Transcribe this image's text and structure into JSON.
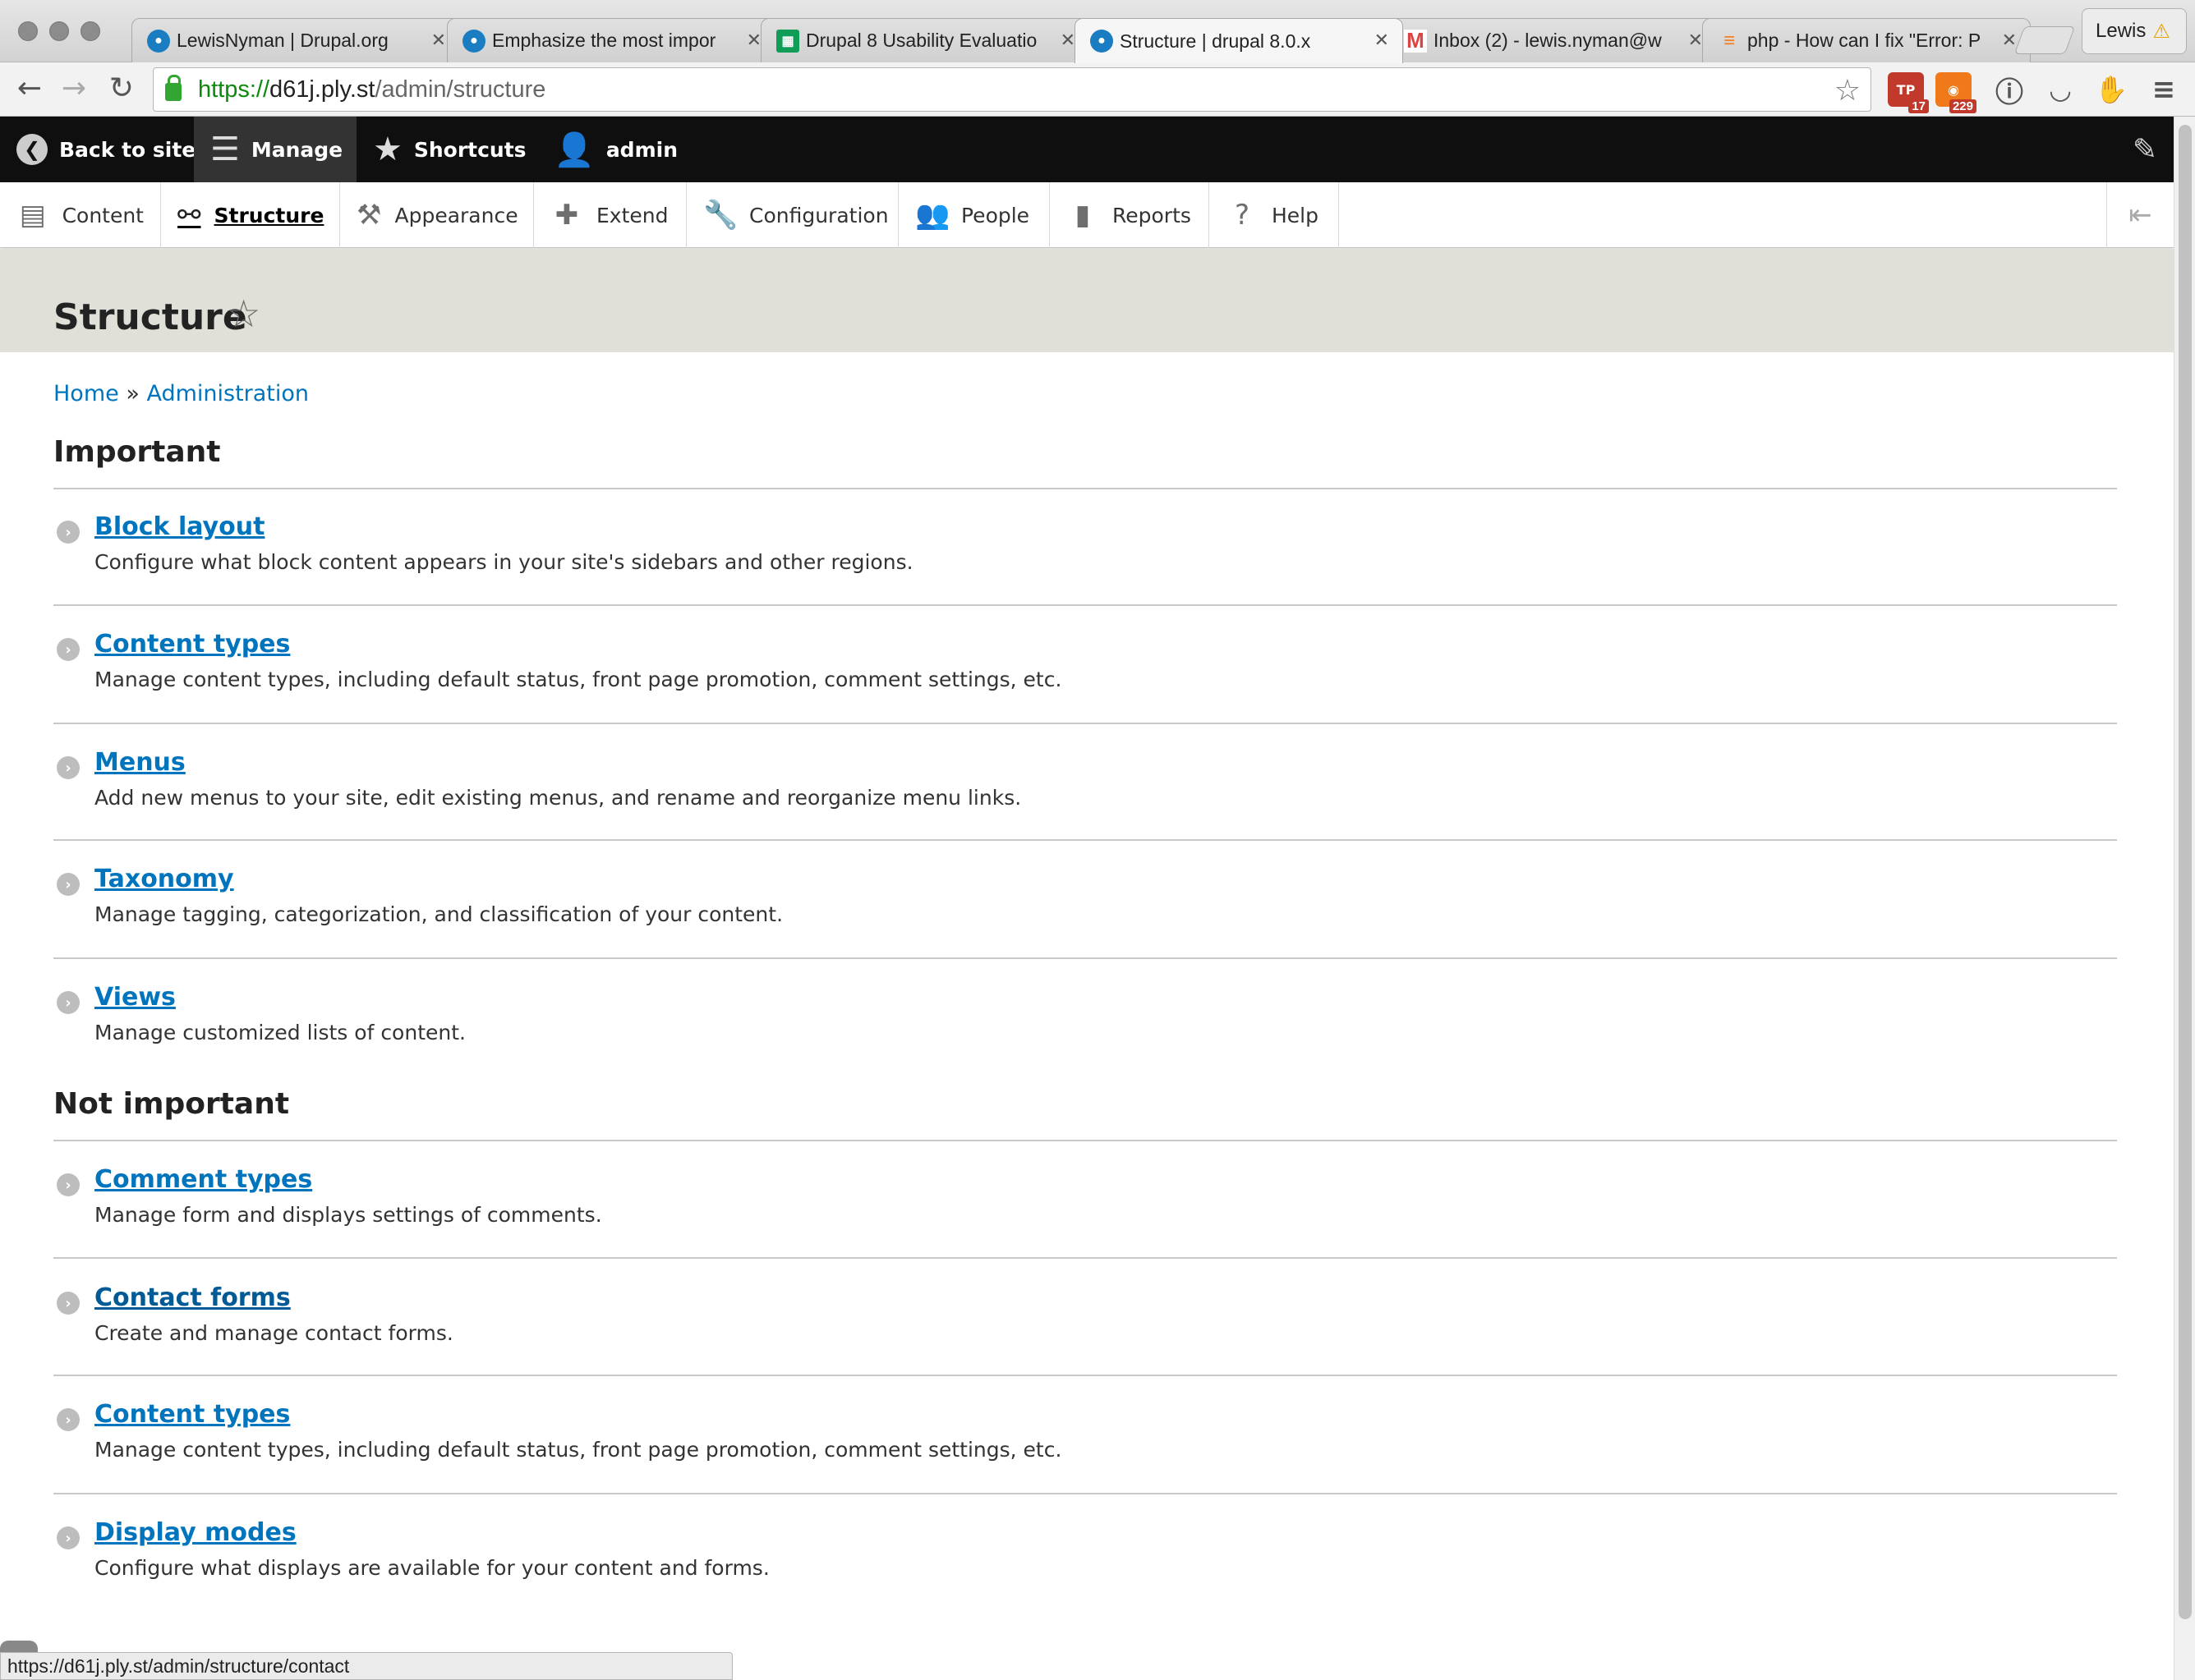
{
  "browser": {
    "tabs": [
      {
        "title": "LewisNyman | Drupal.org",
        "favicon": "drupal-icon",
        "active": false
      },
      {
        "title": "Emphasize the most impor",
        "favicon": "drupal-icon",
        "active": false
      },
      {
        "title": "Drupal 8 Usability Evaluatio",
        "favicon": "sheets-icon",
        "active": false
      },
      {
        "title": "Structure | drupal 8.0.x",
        "favicon": "drupal-icon",
        "active": true
      },
      {
        "title": "Inbox (2) - lewis.nyman@w",
        "favicon": "gmail-icon",
        "active": false
      },
      {
        "title": "php - How can I fix \"Error: P",
        "favicon": "stackoverflow-icon",
        "active": false
      }
    ],
    "profile_name": "Lewis",
    "url": {
      "scheme": "https://",
      "host": "d61j.ply.st",
      "path": "/admin/structure"
    },
    "extensions": [
      {
        "name": "tp-extension-icon",
        "badge": "17",
        "color": "#c0392b"
      },
      {
        "name": "rss-extension-icon",
        "badge": "229",
        "color": "#f07a1a"
      },
      {
        "name": "1password-icon",
        "badge": "",
        "color": "#555555"
      },
      {
        "name": "pocket-icon",
        "badge": "",
        "color": "#555555"
      },
      {
        "name": "hand-icon",
        "badge": "",
        "color": "#e6a100"
      }
    ],
    "status_url": "https://d61j.ply.st/admin/structure/contact"
  },
  "admin_toolbar": {
    "back_to_site": "Back to site",
    "manage": "Manage",
    "shortcuts": "Shortcuts",
    "user": "admin"
  },
  "tray": {
    "items": [
      {
        "label": "Content",
        "icon": "file-icon"
      },
      {
        "label": "Structure",
        "icon": "sitemap-icon",
        "active": true
      },
      {
        "label": "Appearance",
        "icon": "brush-icon"
      },
      {
        "label": "Extend",
        "icon": "puzzle-icon"
      },
      {
        "label": "Configuration",
        "icon": "wrench-icon"
      },
      {
        "label": "People",
        "icon": "people-icon"
      },
      {
        "label": "Reports",
        "icon": "bar-chart-icon"
      },
      {
        "label": "Help",
        "icon": "help-icon"
      }
    ]
  },
  "page": {
    "title": "Structure",
    "breadcrumb": {
      "home": "Home",
      "separator": "»",
      "admin": "Administration"
    },
    "sections": [
      {
        "title": "Important",
        "items": [
          {
            "title": "Block layout",
            "description": "Configure what block content appears in your site's sidebars and other regions."
          },
          {
            "title": "Content types",
            "description": "Manage content types, including default status, front page promotion, comment settings, etc."
          },
          {
            "title": "Menus",
            "description": "Add new menus to your site, edit existing menus, and rename and reorganize menu links."
          },
          {
            "title": "Taxonomy",
            "description": "Manage tagging, categorization, and classification of your content."
          },
          {
            "title": "Views",
            "description": "Manage customized lists of content."
          }
        ]
      },
      {
        "title": "Not important",
        "items": [
          {
            "title": "Comment types",
            "description": "Manage form and displays settings of comments."
          },
          {
            "title": "Contact forms",
            "description": "Create and manage contact forms.",
            "hover": true
          },
          {
            "title": "Content types",
            "description": "Manage content types, including default status, front page promotion, comment settings, etc."
          },
          {
            "title": "Display modes",
            "description": "Configure what displays are available for your content and forms."
          }
        ]
      }
    ]
  }
}
